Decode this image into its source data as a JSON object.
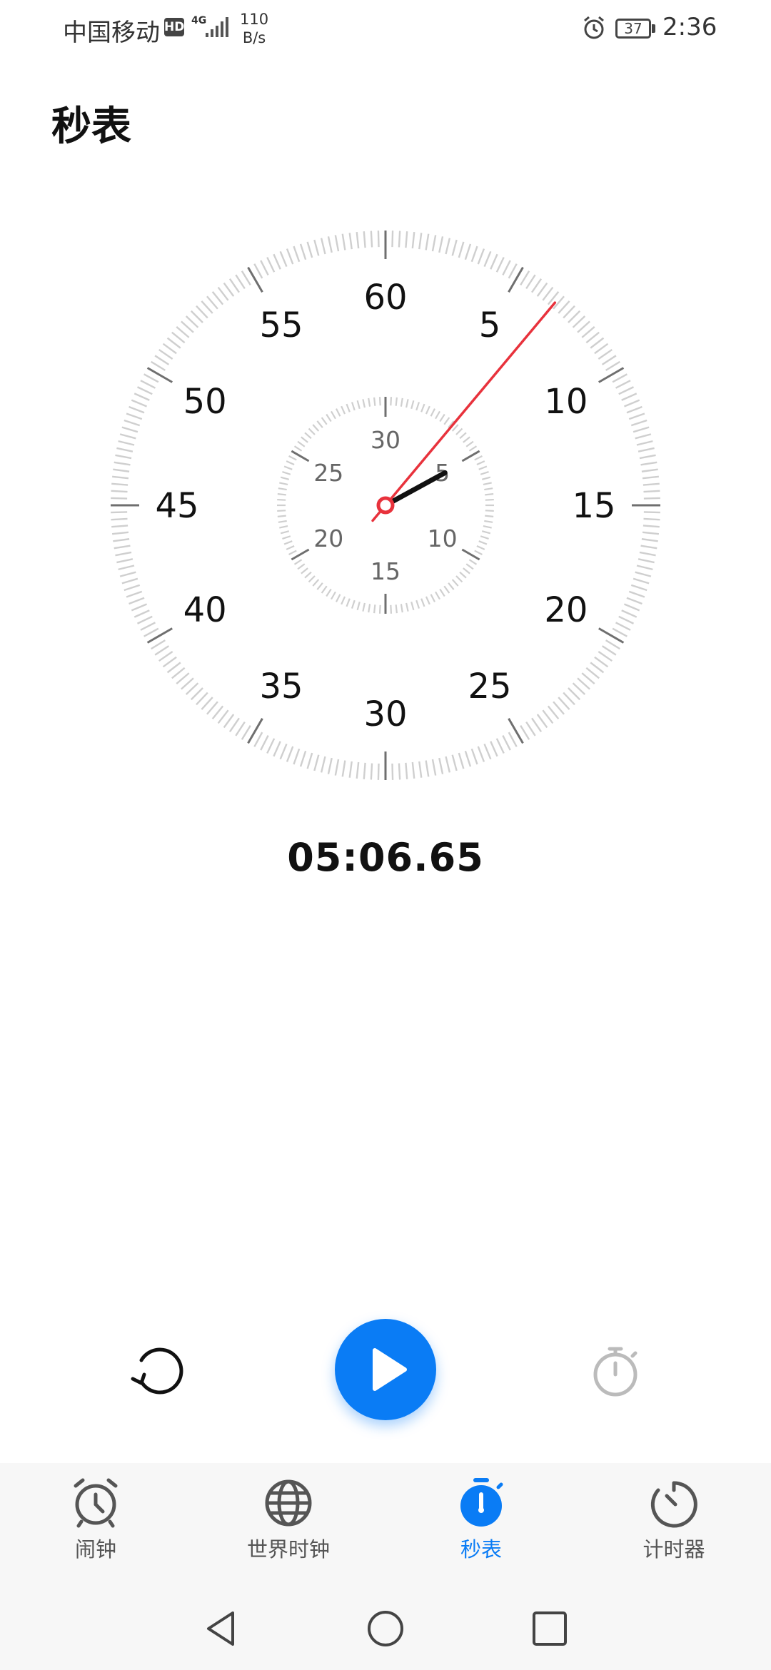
{
  "status_bar": {
    "carrier": "中国移动",
    "hd": "HD",
    "network": "4G",
    "net_speed_value": "110",
    "net_speed_unit": "B/s",
    "battery": "37",
    "time": "2:36"
  },
  "page": {
    "title": "秒表"
  },
  "dial": {
    "outer_labels": [
      "60",
      "5",
      "10",
      "15",
      "20",
      "25",
      "30",
      "35",
      "40",
      "45",
      "50",
      "55"
    ],
    "inner_labels": [
      "30",
      "5",
      "10",
      "15",
      "20",
      "25"
    ],
    "second_hand_seconds": 6.65,
    "minute_hand_minutes": 5.11,
    "accent_color": "#e8323c",
    "minute_hand_color": "#111111"
  },
  "stopwatch": {
    "elapsed": "05:06.65"
  },
  "controls": {
    "reset_icon": "reset-icon",
    "start_icon": "play-icon",
    "lap_icon": "lap-icon",
    "primary_color": "#0a7cf5"
  },
  "nav": {
    "items": [
      {
        "label": "闹钟",
        "icon": "alarm-icon",
        "active": false
      },
      {
        "label": "世界时钟",
        "icon": "globe-icon",
        "active": false
      },
      {
        "label": "秒表",
        "icon": "stopwatch-icon",
        "active": true
      },
      {
        "label": "计时器",
        "icon": "timer-icon",
        "active": false
      }
    ]
  }
}
